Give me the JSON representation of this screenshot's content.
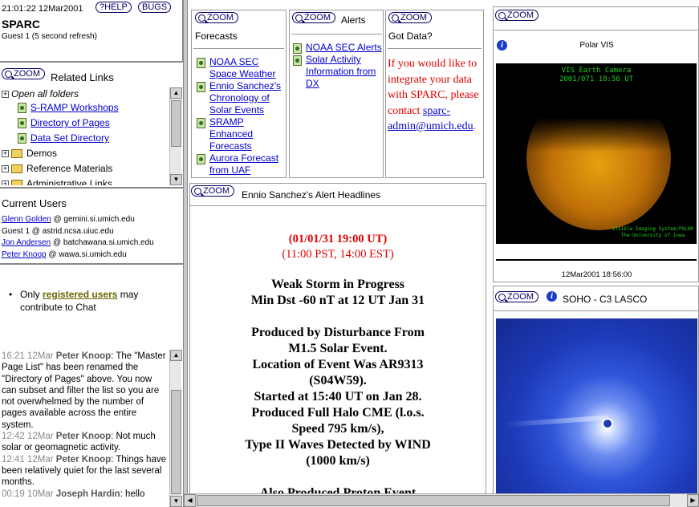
{
  "header": {
    "time": "21:01:22 12Mar2001",
    "help_label": "?HELP",
    "bugs_label": "BUGS",
    "title": "SPARC",
    "subtitle": "Guest 1 (5 second refresh)"
  },
  "zoom_label": "ZOOM",
  "related_links": {
    "title": "Related Links",
    "open_all": "Open all folders",
    "items": [
      "S-RAMP Workshops",
      "Directory of Pages",
      "Data Set Directory"
    ],
    "folders": [
      "Demos",
      "Reference Materials",
      "Administrative Links"
    ]
  },
  "current_users": {
    "title": "Current Users",
    "users": [
      {
        "name": "Glenn Golden",
        "host": "@ gemini.si.umich.edu"
      },
      {
        "name": "",
        "host": "Guest 1 @ astrid.ncsa.uiuc.edu"
      },
      {
        "name": "Jon Andersen",
        "host": "@ batchawana.si.umich.edu"
      },
      {
        "name": "Peter Knoop",
        "host": "@ wawa.si.umich.edu"
      }
    ]
  },
  "chat": {
    "notice_prefix": "Only",
    "notice_link": "registered users",
    "notice_suffix": "may contribute to Chat",
    "messages": [
      {
        "stamp": "16:21 12Mar",
        "author": "Peter Knoop",
        "text": ": The \"Master Page List\" has been renamed the \"Directory of Pages\" above. You now can subset and filter the list so you are not overwhelmed by the number of pages available across the entire system."
      },
      {
        "stamp": "12:42 12Mar",
        "author": "Peter Knoop",
        "text": ": Not much solar or geomagnetic activity."
      },
      {
        "stamp": "12:41 12Mar",
        "author": "Peter Knoop",
        "text": ": Things have been relatively quiet for the last several months."
      },
      {
        "stamp": "00:19 10Mar",
        "author": "Joseph Hardin",
        "text": ": hello"
      }
    ]
  },
  "forecasts": {
    "title": "Forecasts",
    "items": [
      "NOAA SEC Space Weather",
      "Ennio Sanchez's Chronology of Solar Events",
      "SRAMP Enhanced Forecasts",
      "Aurora Forecast from UAF"
    ]
  },
  "alerts": {
    "title": "Alerts",
    "items": [
      "NOAA SEC Alerts",
      "Solar Activity Information from DX"
    ]
  },
  "got_data": {
    "title": "Got Data?",
    "text": "If you would like to integrate your data with SPARC, please contact",
    "email": "sparc-admin@umich.edu",
    "period": "."
  },
  "headlines": {
    "title": "Ennio Sanchez's Alert Headlines",
    "date_line1": "(01/01/31 19:00 UT)",
    "date_line2": "(11:00 PST, 14:00 EST)",
    "body": [
      "Weak Storm in Progress",
      "Min Dst -60 nT at 12 UT Jan 31",
      "",
      "Produced by Disturbance From",
      "M1.5 Solar Event.",
      "Location of Event Was AR9313",
      "(S04W59).",
      "Started at 15:40 UT on Jan 28.",
      "Produced Full Halo CME (l.o.s.",
      "Speed 795 km/s),",
      "Type II Waves Detected by WIND",
      "(1000 km/s)",
      "",
      "Also Produced Proton Event"
    ]
  },
  "polar_vis": {
    "title": "Polar VIS",
    "img_line1": "VIS Earth Camera",
    "img_line2": "2001/071 18:56 UT",
    "img_credit1": "Visible Imaging System/POLAR",
    "img_credit2": "The University of Iowa",
    "timestamp": "12Mar2001 18:56:00"
  },
  "soho": {
    "title": "SOHO - C3 LASCO"
  },
  "colors": {
    "alert_red": "#e00000",
    "link_blue": "#0000cc",
    "zoom_blue": "#000066"
  }
}
